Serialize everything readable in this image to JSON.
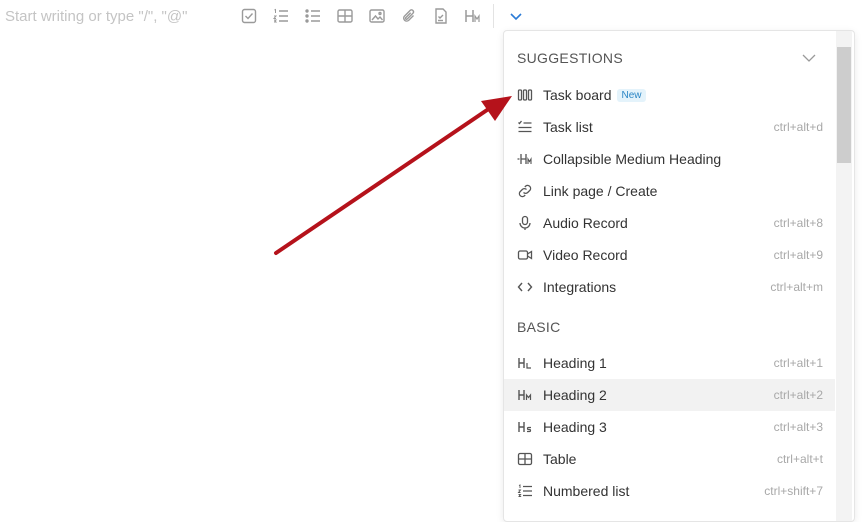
{
  "editor": {
    "placeholder": "Start writing or type \"/\", \"@\""
  },
  "toolbar": {
    "buttons": [
      "checkbox-icon",
      "numbered-list-icon",
      "bullet-list-icon",
      "table-icon",
      "image-icon",
      "attachment-icon",
      "document-icon",
      "heading-icon"
    ],
    "expand_icon": "chevron-down-icon",
    "accent": "#2b7bd6"
  },
  "menu": {
    "suggestions": {
      "title": "SUGGESTIONS",
      "items": [
        {
          "icon": "task-board-icon",
          "label": "Task board",
          "badge": "New",
          "shortcut": ""
        },
        {
          "icon": "task-list-icon",
          "label": "Task list",
          "shortcut": "ctrl+alt+d"
        },
        {
          "icon": "collapsible-heading-icon",
          "label": "Collapsible Medium Heading",
          "shortcut": ""
        },
        {
          "icon": "link-icon",
          "label": "Link page / Create",
          "shortcut": ""
        },
        {
          "icon": "microphone-icon",
          "label": "Audio Record",
          "shortcut": "ctrl+alt+8"
        },
        {
          "icon": "video-camera-icon",
          "label": "Video Record",
          "shortcut": "ctrl+alt+9"
        },
        {
          "icon": "code-icon",
          "label": "Integrations",
          "shortcut": "ctrl+alt+m"
        }
      ]
    },
    "basic": {
      "title": "BASIC",
      "items": [
        {
          "icon": "heading-1-icon",
          "label": "Heading 1",
          "shortcut": "ctrl+alt+1"
        },
        {
          "icon": "heading-2-icon",
          "label": "Heading 2",
          "shortcut": "ctrl+alt+2"
        },
        {
          "icon": "heading-3-icon",
          "label": "Heading 3",
          "shortcut": "ctrl+alt+3"
        },
        {
          "icon": "table-icon",
          "label": "Table",
          "shortcut": "ctrl+alt+t"
        },
        {
          "icon": "numbered-list-icon",
          "label": "Numbered list",
          "shortcut": "ctrl+shift+7"
        }
      ]
    },
    "hover_color": "#f2f2f2"
  },
  "annotation": {
    "arrow_color": "#b5121b"
  }
}
